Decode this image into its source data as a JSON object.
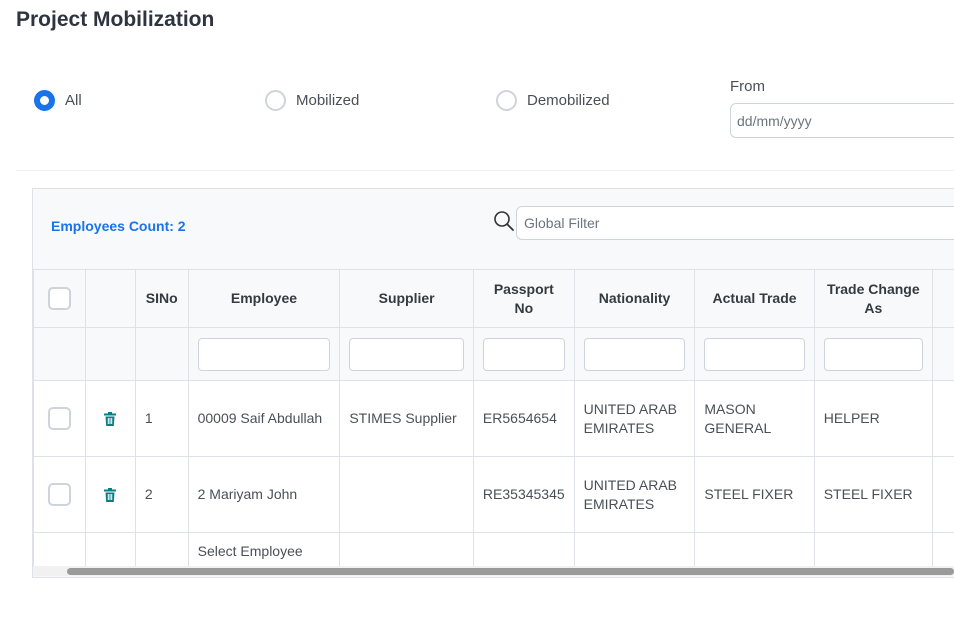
{
  "title": "Project Mobilization",
  "filters": {
    "options": [
      {
        "label": "All",
        "selected": true
      },
      {
        "label": "Mobilized",
        "selected": false
      },
      {
        "label": "Demobilized",
        "selected": false
      }
    ],
    "from_label": "From",
    "from_placeholder": "dd/mm/yyyy"
  },
  "table": {
    "count_label": "Employees Count: 2",
    "search_icon": "search-icon",
    "global_filter_placeholder": "Global Filter",
    "columns": [
      "SINo",
      "Employee",
      "Supplier",
      "Passport No",
      "Nationality",
      "Actual Trade",
      "Trade Change As"
    ],
    "rows": [
      {
        "sino": "1",
        "employee": "00009 Saif Abdullah",
        "supplier": "STIMES Supplier",
        "passport": "ER5654654",
        "nationality": "UNITED ARAB EMIRATES",
        "actual_trade": "MASON GENERAL",
        "trade_change": "HELPER"
      },
      {
        "sino": "2",
        "employee": "2 Mariyam John",
        "supplier": "",
        "passport": "RE35345345",
        "nationality": "UNITED ARAB EMIRATES",
        "actual_trade": "STEEL FIXER",
        "trade_change": "STEEL FIXER"
      }
    ],
    "add_row_placeholder": "Select Employee",
    "row_action_icon": "trash-icon",
    "accent_color": "#1a73e8",
    "trash_color": "#0e7c86"
  }
}
